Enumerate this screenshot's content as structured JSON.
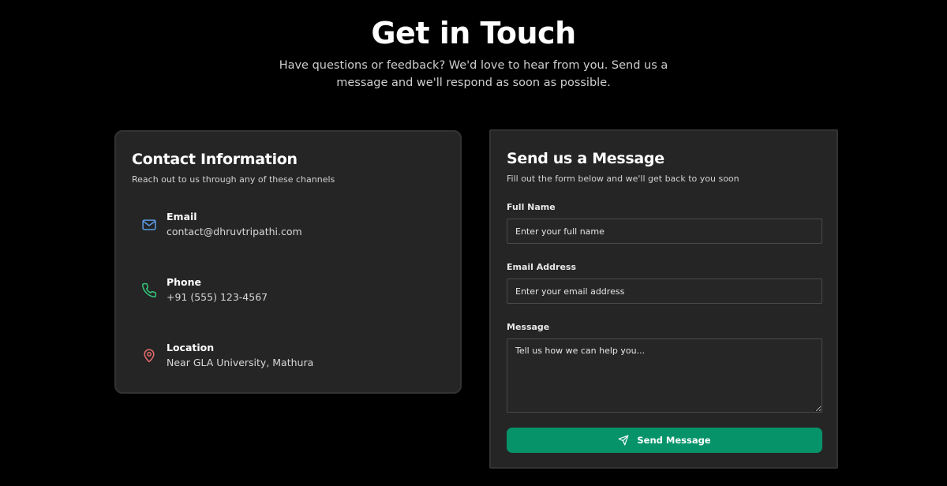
{
  "hero": {
    "title": "Get in Touch",
    "subtitle": "Have questions or feedback? We'd love to hear from you. Send us a message and we'll respond as soon as possible."
  },
  "contact": {
    "title": "Contact Information",
    "subtitle": "Reach out to us through any of these channels",
    "items": [
      {
        "icon": "mail-icon",
        "label": "Email",
        "value": "contact@dhruvtripathi.com",
        "color": "#5b9ce6"
      },
      {
        "icon": "phone-icon",
        "label": "Phone",
        "value": "+91 (555) 123-4567",
        "color": "#34c77b"
      },
      {
        "icon": "map-pin-icon",
        "label": "Location",
        "value": "Near GLA University, Mathura",
        "color": "#e56b6b"
      }
    ]
  },
  "form": {
    "title": "Send us a Message",
    "subtitle": "Fill out the form below and we'll get back to you soon",
    "name_label": "Full Name",
    "name_placeholder": "Enter your full name",
    "email_label": "Email Address",
    "email_placeholder": "Enter your email address",
    "message_label": "Message",
    "message_placeholder": "Tell us how we can help you...",
    "submit_label": "Send Message",
    "submit_color": "#06936a"
  }
}
